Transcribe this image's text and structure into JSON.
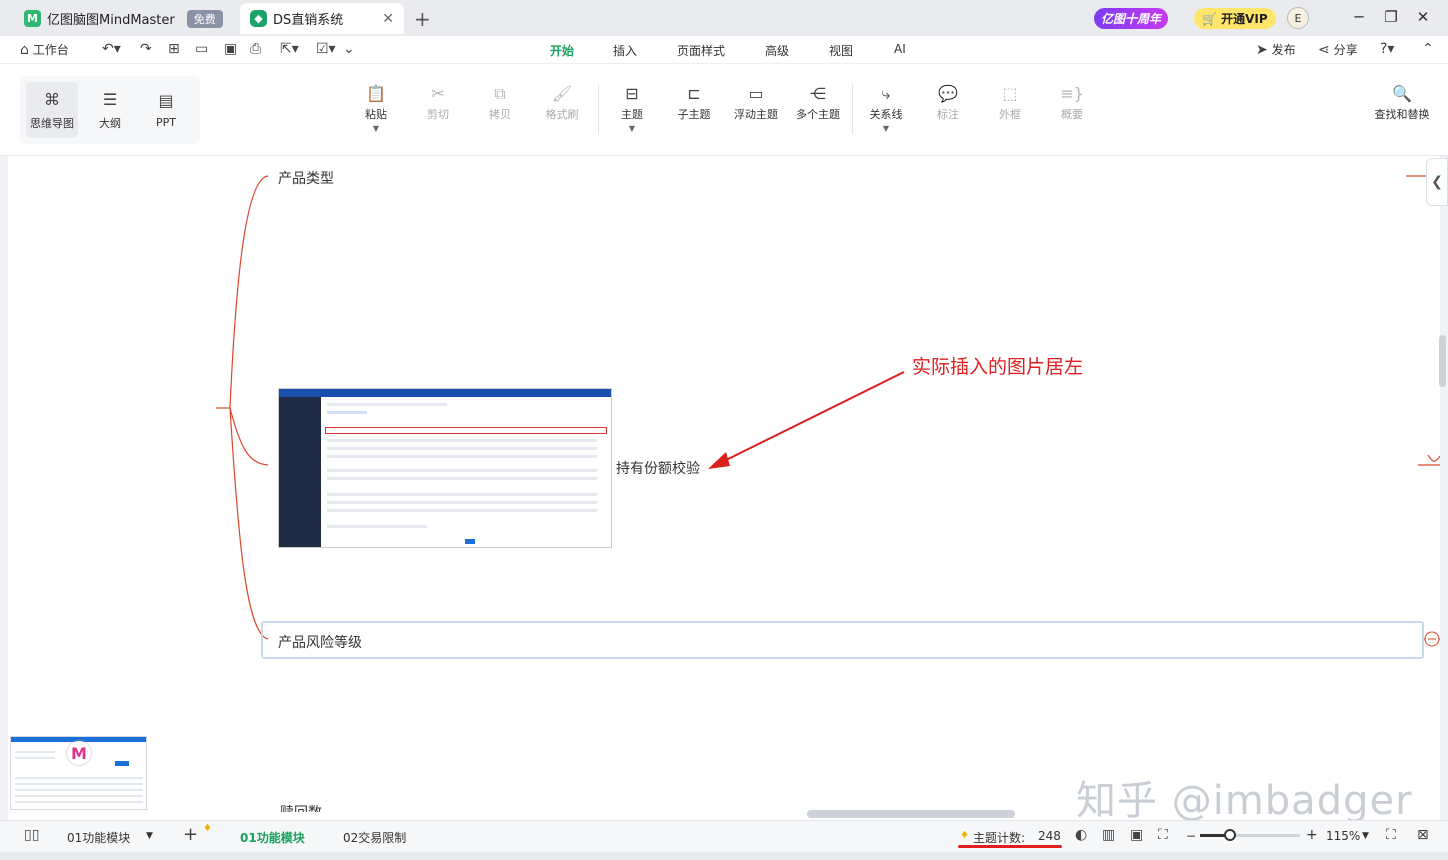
{
  "titlebar": {
    "app_tab": "亿图脑图MindMaster",
    "free_badge": "免费",
    "doc_tab": "DS直销系统",
    "promo": "亿图十周年",
    "vip": "开通VIP",
    "avatar": "E"
  },
  "menubar": {
    "workspace": "工作台",
    "tabs": [
      "开始",
      "插入",
      "页面样式",
      "高级",
      "视图",
      "AI"
    ],
    "active_tab": "开始",
    "publish": "发布",
    "share": "分享"
  },
  "ribbon": {
    "view_modes": [
      "思维导图",
      "大纲",
      "PPT"
    ],
    "tools": {
      "paste": "粘贴",
      "cut": "剪切",
      "copy": "拷贝",
      "format_painter": "格式刷",
      "topic": "主题",
      "subtopic": "子主题",
      "floating_topic": "浮动主题",
      "multiple_topics": "多个主题",
      "relationship": "关系线",
      "callout": "标注",
      "boundary": "外框",
      "summary": "概要",
      "find_replace": "查找和替换"
    }
  },
  "canvas": {
    "topics": {
      "product_type": "产品类型",
      "holding_check": "持有份额校验",
      "product_risk": "产品风险等级",
      "partial": "赎回数"
    },
    "annotation": "实际插入的图片居左",
    "watermark": "知乎 @imbadger"
  },
  "statusbar": {
    "sheet_select": "01功能模块",
    "tabs": [
      "01功能模块",
      "02交易限制"
    ],
    "active_tab": "01功能模块",
    "topic_count_label": "主题计数:",
    "topic_count": "248",
    "zoom": "115%"
  },
  "colors": {
    "accent": "#19a15f",
    "branch": "#d9472b",
    "annotation": "#e02020"
  }
}
